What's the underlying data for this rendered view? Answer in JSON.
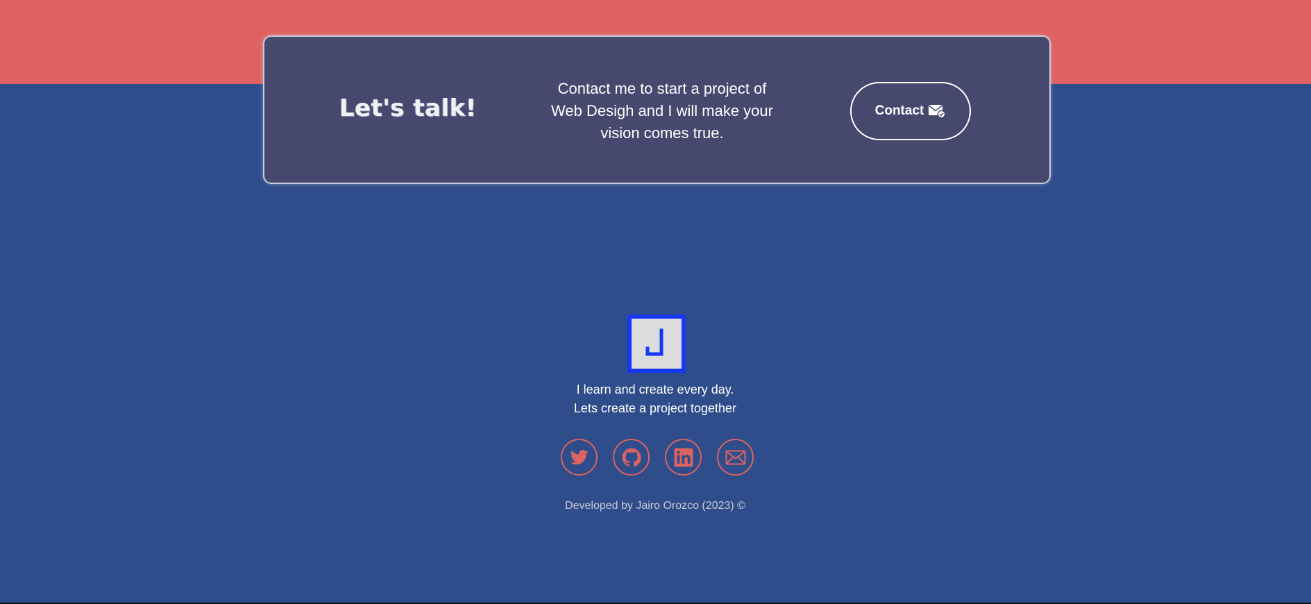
{
  "cta": {
    "title": "Let's talk!",
    "text_line1": "Contact me to start a project of",
    "text_line2": "Web Desigh and I will make your",
    "text_line3": "vision comes true.",
    "button_label": "Contact",
    "button_icon": "mail-check-icon"
  },
  "footer": {
    "logo_letter": "J",
    "tagline_line1": "I learn and create every day.",
    "tagline_line2": "Lets create a project together",
    "socials": [
      {
        "icon": "twitter-icon"
      },
      {
        "icon": "github-icon"
      },
      {
        "icon": "linkedin-icon"
      },
      {
        "icon": "email-icon"
      }
    ],
    "credit": "Developed by Jairo Orozco (2023) ©"
  },
  "colors": {
    "accent": "#de6262",
    "background": "#2f4d8a",
    "card": "#46486e",
    "logo_border": "#1538f5"
  }
}
